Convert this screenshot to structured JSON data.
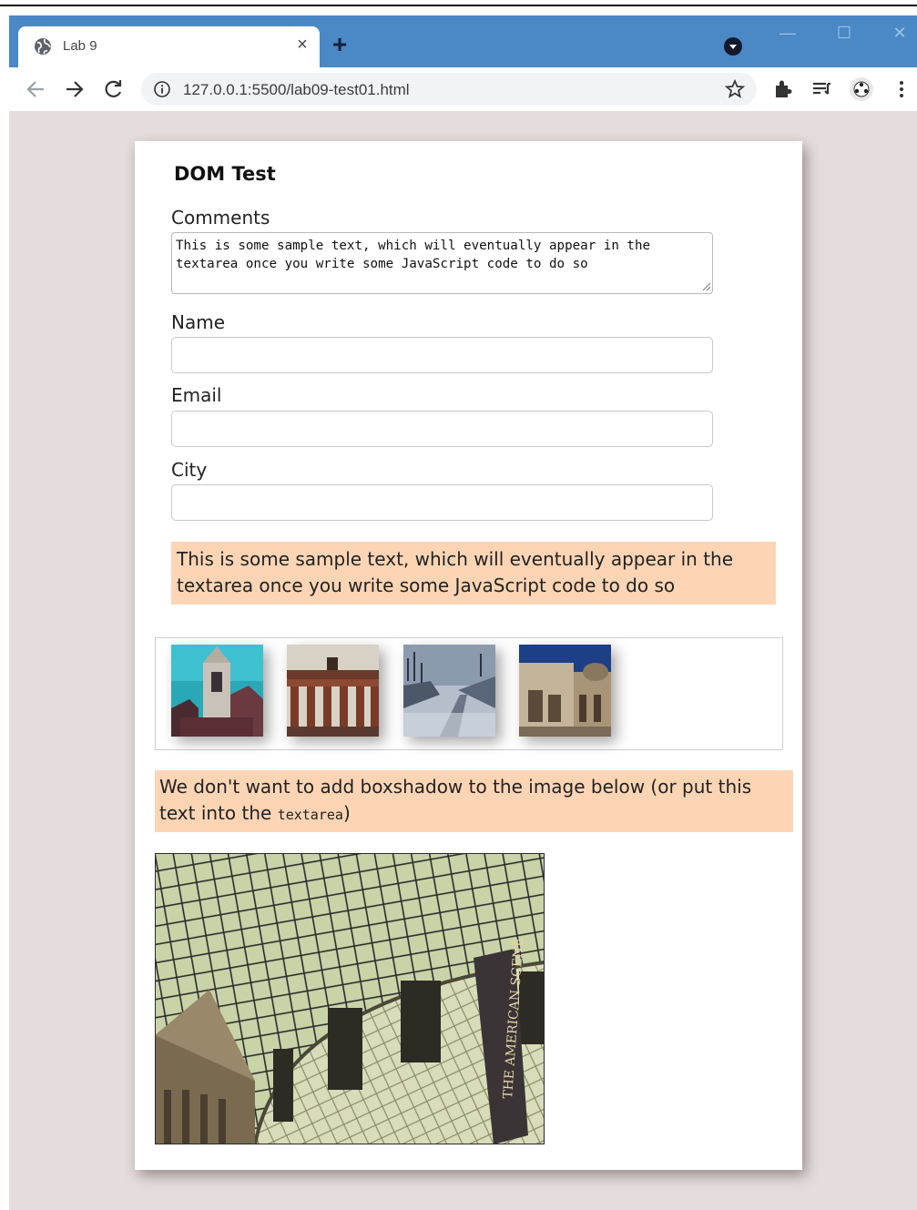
{
  "browser": {
    "tab": {
      "title": "Lab 9",
      "favicon": "globe-icon",
      "close": "×"
    },
    "new_tab": "+",
    "window_controls": {
      "minimize": "—",
      "maximize": "☐",
      "close": "✕"
    },
    "address": {
      "url": "127.0.0.1:5500/lab09-test01.html",
      "info_icon": "info-icon",
      "bookmark_icon": "star-icon"
    },
    "toolbar_icons": [
      "back-arrow-icon",
      "forward-arrow-icon",
      "reload-icon",
      "extensions-icon",
      "reading-list-icon",
      "profile-avatar-icon",
      "menu-dots-icon"
    ],
    "accent_color": "#4a88c6"
  },
  "page": {
    "title": "DOM Test",
    "form": {
      "comments_label": "Comments",
      "comments_value": "This is some sample text, which will eventually appear in the textarea once you write some JavaScript code to do so",
      "name_label": "Name",
      "name_value": "",
      "email_label": "Email",
      "email_value": "",
      "city_label": "City",
      "city_value": ""
    },
    "note_1": "This is some sample text, which will eventually appear in the textarea once you write some JavaScript code to do so",
    "gallery": {
      "images": [
        "church-photo",
        "brandenburg-gate-photo",
        "snowy-road-photo",
        "roman-arch-photo"
      ]
    },
    "note_2": {
      "before": "We don't want to add boxshadow to the image below (or put this text into the ",
      "code": "textarea",
      "after": ")"
    },
    "hero_image": {
      "name": "british-museum-great-court-photo",
      "banner_text": "THE AMERICAN SCENE"
    },
    "colors": {
      "note_background": "#fdd5b4",
      "page_background": "#e5dddd"
    }
  }
}
